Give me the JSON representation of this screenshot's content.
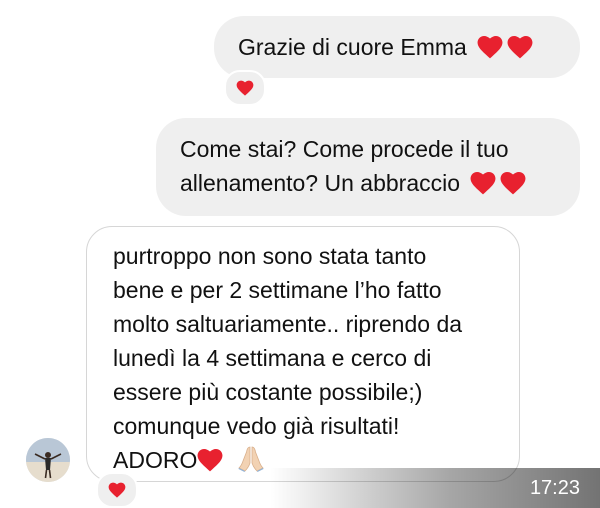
{
  "messages": [
    {
      "direction": "outgoing",
      "lines": [
        "Grazie di cuore Emma"
      ],
      "trailing_icons": [
        "heart-icon",
        "heart-icon"
      ],
      "reaction": "heart-icon"
    },
    {
      "direction": "outgoing",
      "lines": [
        "Come stai? Come procede il tuo",
        "allenamento? Un abbraccio"
      ],
      "trailing_icons": [
        "heart-icon",
        "heart-icon"
      ]
    },
    {
      "direction": "incoming",
      "lines": [
        "purtroppo non sono stata tanto",
        "bene e per 2 settimane l’ho fatto",
        "molto saltuariamente.. riprendo da",
        "lunedì la 4 settimana e cerco di",
        "essere più costante possibile;)",
        "comunque vedo già risultati!",
        "ADORO"
      ],
      "trailing_icons": [
        "heart-icon",
        "praying-hands-icon"
      ],
      "reaction": "heart-icon"
    }
  ],
  "status": {
    "time": "17:23"
  },
  "colors": {
    "outgoing_bubble": "#efefef",
    "incoming_border": "#d6d6d6",
    "heart": "#e8212f"
  }
}
